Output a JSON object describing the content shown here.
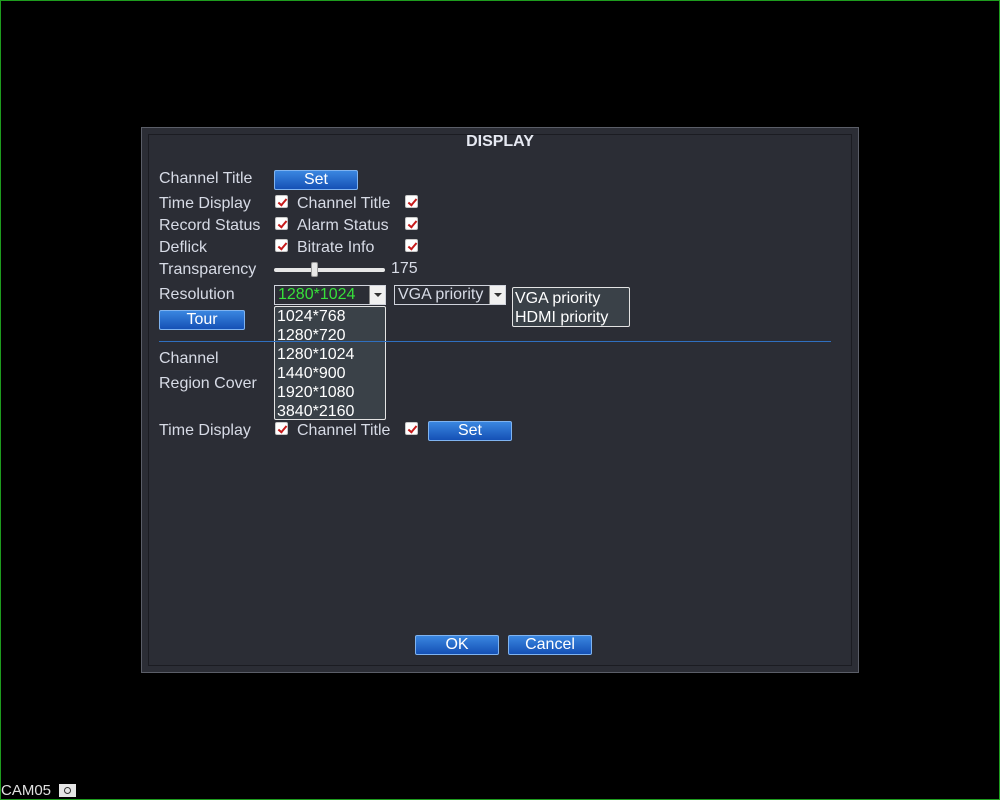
{
  "dialog": {
    "title": "DISPLAY",
    "channel_title_label": "Channel Title",
    "set_label": "Set",
    "time_display_label": "Time Display",
    "channel_title_cb_label": "Channel Title",
    "record_status_label": "Record Status",
    "alarm_status_label": "Alarm Status",
    "deflick_label": "Deflick",
    "bitrate_info_label": "Bitrate Info",
    "transparency_label": "Transparency",
    "transparency_value": "175",
    "transparency_level": 0.35,
    "resolution_label": "Resolution",
    "resolution_value": "1280*1024",
    "resolution_options": [
      "1024*768",
      "1280*720",
      "1280*1024",
      "1440*900",
      "1920*1080",
      "3840*2160"
    ],
    "output_priority_value": "VGA priority",
    "output_priority_options": [
      "VGA priority",
      "HDMI priority"
    ],
    "tour_label": "Tour",
    "channel_label": "Channel",
    "region_cover_label": "Region Cover",
    "time_display2_label": "Time Display",
    "channel_title2_label": "Channel Title",
    "set2_label": "Set",
    "ok_label": "OK",
    "cancel_label": "Cancel"
  },
  "checkboxes": {
    "time_display": true,
    "channel_title": true,
    "record_status": true,
    "alarm_status": true,
    "deflick": true,
    "bitrate_info": true,
    "time_display2": true,
    "channel_title2": true
  },
  "footer": {
    "camera_label": "CAM05"
  },
  "colors": {
    "accent": "#1f66cc",
    "selected_text": "#37e03a",
    "checkmark": "#c61a1a"
  }
}
